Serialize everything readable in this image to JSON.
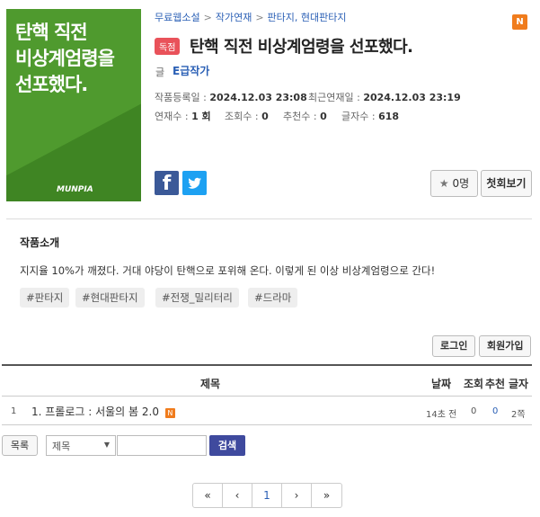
{
  "cover": {
    "title_lines": [
      "탄핵 직전",
      "비상계엄령을",
      "선포했다."
    ],
    "logo": "MUNPIA"
  },
  "breadcrumb": [
    "무료웹소설",
    "작가연재",
    "판타지, 현대판타지"
  ],
  "new_badge": "N",
  "exclusive_badge": "독점",
  "title": "탄핵 직전 비상계엄령을 선포했다.",
  "author_label": "글",
  "author": "E급작가",
  "meta": {
    "registered_label": "작품등록일 :",
    "registered": "2024.12.03 23:08",
    "latest_label": "최근연재일 :",
    "latest": "2024.12.03 23:19",
    "episodes_label": "연재수 :",
    "episodes": "1 회",
    "views_label": "조회수 :",
    "views": "0",
    "recommends_label": "추천수 :",
    "recommends": "0",
    "chars_label": "글자수 :",
    "chars": "618"
  },
  "buttons": {
    "recommend": "0명",
    "first_view": "첫회보기",
    "login": "로그인",
    "signup": "회원가입",
    "list": "목록",
    "search": "검색"
  },
  "intro": {
    "heading": "작품소개",
    "text": "지지율 10%가 깨졌다. 거대 야당이 탄핵으로 포위해 온다. 이렇게 된 이상 비상계엄령으로 간다!"
  },
  "tags": [
    "#판타지",
    "#현대판타지",
    "#전쟁_밀리터리",
    "#드라마"
  ],
  "table": {
    "headers": {
      "title": "제목",
      "date": "날짜",
      "views": "조회",
      "recommends": "추천",
      "chars": "글자"
    },
    "rows": [
      {
        "num": "1",
        "title": "1. 프롤로그 : 서울의 봄 2.0",
        "badge": "N",
        "date": "14초 전",
        "views": "0",
        "recommends": "0",
        "chars": "2쪽"
      }
    ]
  },
  "search": {
    "select_value": "제목"
  },
  "pager": [
    "«",
    "‹",
    "1",
    "›",
    "»"
  ],
  "colors": {
    "cover_green": "#4f9a2e",
    "link_blue": "#2a5fb5",
    "exclusive_red": "#e9525a",
    "search_button": "#3f4a9e",
    "new_orange": "#f07c1d"
  }
}
